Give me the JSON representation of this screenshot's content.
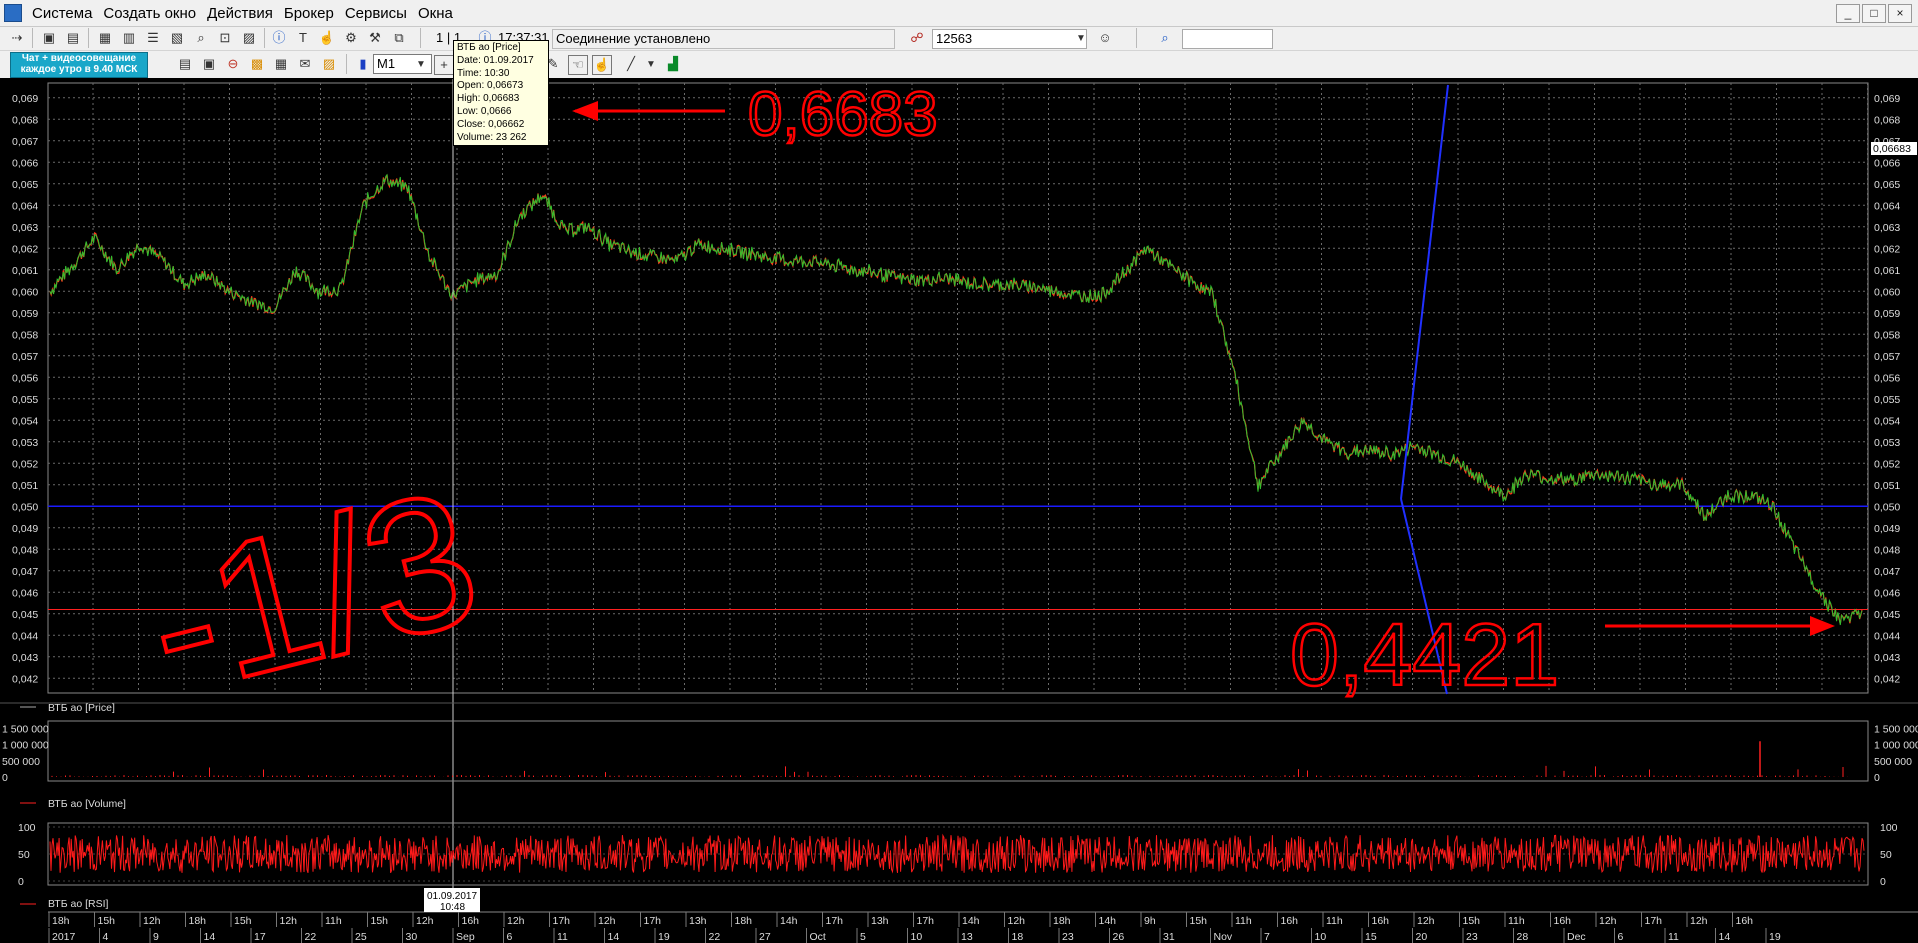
{
  "window": {
    "menu": [
      "Система",
      "Создать окно",
      "Действия",
      "Брокер",
      "Сервисы",
      "Окна"
    ],
    "controls": [
      "_",
      "□",
      "×"
    ]
  },
  "toolbar": {
    "page_indicator": "1 | 1",
    "time": "17:37:31",
    "connection_status": "Соединение установлено",
    "account": "12563",
    "timeframe": "M1",
    "ad_banner_line1": "Чат + видеосовещание",
    "ad_banner_line2": "каждое утро в 9.40 МСК",
    "icons": [
      "arrow-icon",
      "window-icon",
      "table-icon",
      "list-icon",
      "chart-icon",
      "info-icon",
      "text-icon",
      "hand-icon",
      "search-icon",
      "user-icon",
      "bars-icon",
      "crosshair-icon",
      "pencil-icon",
      "line-icon",
      "indicator-icon"
    ]
  },
  "tooltip": {
    "title": "ВТБ ао [Price]",
    "date": "Date: 01.09.2017",
    "time": "Time: 10:30",
    "open": "Open:  0,06673",
    "high": "High:  0,06683",
    "low": "Low:   0,0666",
    "close": "Close: 0,06662",
    "volume": "Volume: 23 262"
  },
  "annotations": {
    "high_note": "0,6683",
    "low_note": "0,4421",
    "ratio_note": "-1/3"
  },
  "colors": {
    "price_line": "#ff3a1a",
    "price_line2": "#2fbf2f",
    "horizontal_level": "#1a1aff",
    "red_level": "#ff2020",
    "grid": "#6a6a6a",
    "annotation": "#ff0000"
  },
  "chart_data": [
    {
      "type": "line",
      "series_label": "ВТБ ао [Price]",
      "y_ticks": [
        "0,069",
        "0,068",
        "0,067",
        "0,066",
        "0,065",
        "0,064",
        "0,063",
        "0,062",
        "0,061",
        "0,060",
        "0,059",
        "0,058",
        "0,057",
        "0,056",
        "0,055",
        "0,054",
        "0,053",
        "0,052",
        "0,051",
        "0,050",
        "0,049",
        "0,048",
        "0,047",
        "0,046",
        "0,045",
        "0,044",
        "0,043",
        "0,042"
      ],
      "ylim": [
        0.0415,
        0.0695
      ],
      "last_price_label": "0,06683",
      "horizontal_levels": [
        0.05,
        0.0452
      ],
      "values": [
        0.06,
        0.0612,
        0.0625,
        0.061,
        0.0622,
        0.0615,
        0.0603,
        0.0608,
        0.06,
        0.0595,
        0.0592,
        0.061,
        0.06,
        0.0601,
        0.064,
        0.0652,
        0.0648,
        0.0615,
        0.0598,
        0.0605,
        0.0608,
        0.0635,
        0.0645,
        0.0628,
        0.063,
        0.0622,
        0.0618,
        0.0616,
        0.0614,
        0.0622,
        0.062,
        0.0618,
        0.0616,
        0.0614,
        0.0614,
        0.0612,
        0.061,
        0.0608,
        0.0606,
        0.0605,
        0.0606,
        0.0604,
        0.0603,
        0.0603,
        0.0602,
        0.06,
        0.0598,
        0.0598,
        0.0608,
        0.062,
        0.0612,
        0.0605,
        0.0598,
        0.056,
        0.051,
        0.0525,
        0.054,
        0.053,
        0.0525,
        0.0526,
        0.0524,
        0.0528,
        0.0524,
        0.052,
        0.0512,
        0.0505,
        0.0515,
        0.0513,
        0.0512,
        0.0515,
        0.0514,
        0.0512,
        0.051,
        0.051,
        0.0495,
        0.0505,
        0.0505,
        0.05,
        0.048,
        0.0462,
        0.0447,
        0.045
      ]
    },
    {
      "type": "bar",
      "series_label": "ВТБ ао [Volume]",
      "y_ticks_left": [
        "1 500 000",
        "1 000 000",
        "500 000",
        "0"
      ],
      "y_ticks_right": [
        "1 500 000",
        "1 000 000",
        "500 000",
        "0"
      ],
      "ylim": [
        0,
        1600000
      ]
    },
    {
      "type": "line",
      "series_label": "ВТБ ао [RSI]",
      "y_ticks": [
        "100",
        "50",
        "0"
      ],
      "ylim": [
        0,
        100
      ]
    }
  ],
  "x_axis": {
    "crosshair_label_line1": "01.09.2017",
    "crosshair_label_line2": "10:48",
    "row1": [
      "18h",
      "15h",
      "12h",
      "18h",
      "15h",
      "12h",
      "11h",
      "15h",
      "12h",
      "16h",
      "12h",
      "17h",
      "12h",
      "17h",
      "13h",
      "18h",
      "14h",
      "17h",
      "13h",
      "17h",
      "14h",
      "12h",
      "18h",
      "14h",
      "9h",
      "15h",
      "11h",
      "16h",
      "11h",
      "16h",
      "12h",
      "15h",
      "11h",
      "16h",
      "12h",
      "17h",
      "12h",
      "16h"
    ],
    "row2": [
      "2017",
      "4",
      "9",
      "14",
      "17",
      "22",
      "25",
      "30",
      "Sep",
      "6",
      "11",
      "14",
      "19",
      "22",
      "27",
      "Oct",
      "5",
      "10",
      "13",
      "18",
      "23",
      "26",
      "31",
      "Nov",
      "7",
      "10",
      "15",
      "20",
      "23",
      "28",
      "Dec",
      "6",
      "11",
      "14",
      "19"
    ]
  }
}
